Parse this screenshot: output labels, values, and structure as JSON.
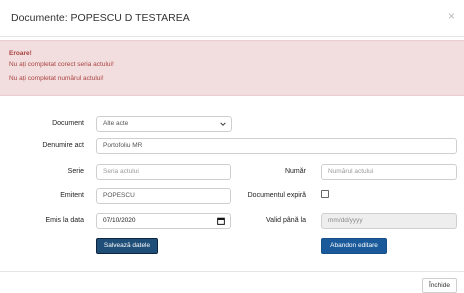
{
  "modal": {
    "title": "Documente: POPESCU D TESTAREA",
    "close_glyph": "×"
  },
  "alert": {
    "title": "Eroare!",
    "messages": [
      "Nu ați completat corect seria actului!",
      "Nu ați completat numărul actului!"
    ]
  },
  "form": {
    "document": {
      "label": "Document",
      "value": "Alte acte"
    },
    "denumire": {
      "label": "Denumire act",
      "value": "Portofoliu MR"
    },
    "serie": {
      "label": "Serie",
      "placeholder": "Seria actului"
    },
    "numar": {
      "label": "Număr",
      "placeholder": "Numărul actului"
    },
    "emitent": {
      "label": "Emitent",
      "value": "POPESCU"
    },
    "expira": {
      "label": "Documentul expiră",
      "checked": false
    },
    "emis": {
      "label": "Emis la data",
      "value": "07/10/2020"
    },
    "valid": {
      "label": "Valid până la",
      "placeholder": "mm/dd/yyyy"
    }
  },
  "buttons": {
    "save": "Salvează datele",
    "abandon": "Abandon editare",
    "close": "Închide"
  },
  "colors": {
    "primary": "#1f4e79",
    "alert_bg": "#f2dede",
    "alert_text": "#a94442"
  }
}
